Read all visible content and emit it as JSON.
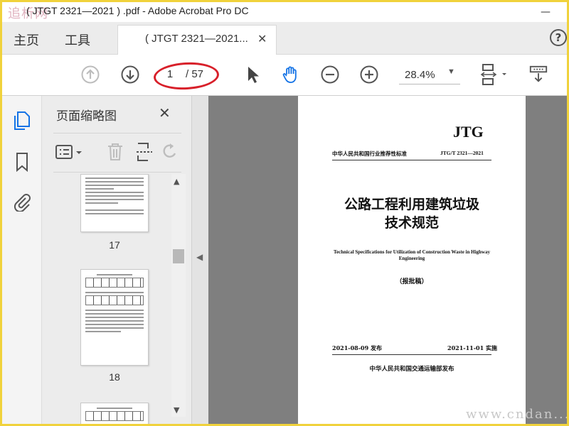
{
  "window": {
    "title": "( JTGT 2321—2021 ) .pdf - Adobe Acrobat Pro DC",
    "logo_watermark": "追析网",
    "minimize": "—"
  },
  "tabs": {
    "home": "主页",
    "tools": "工具",
    "document": "( JTGT 2321—2021...",
    "close": "✕",
    "help": "?"
  },
  "toolbar": {
    "current_page": "1",
    "total_pages": "/ 57",
    "zoom": "28.4%",
    "zoom_caret": "▼"
  },
  "thumbnail_panel": {
    "title": "页面缩略图",
    "close": "✕",
    "pages": [
      "17",
      "18"
    ]
  },
  "document_page": {
    "header": "JTG",
    "category": "中华人民共和国行业推荐性标准",
    "code": "JTG/T 2321—2021",
    "title_line1": "公路工程利用建筑垃圾",
    "title_line2": "技术规范",
    "english_title": "Technical Specifications for Utilization of Construction Waste in Highway Engineering",
    "draft": "（报批稿）",
    "issue_date": "2021-08-09 发布",
    "implement_date": "2021-11-01 实施",
    "publisher": "中华人民共和国交通运输部发布"
  },
  "watermark": "www.cndan..."
}
